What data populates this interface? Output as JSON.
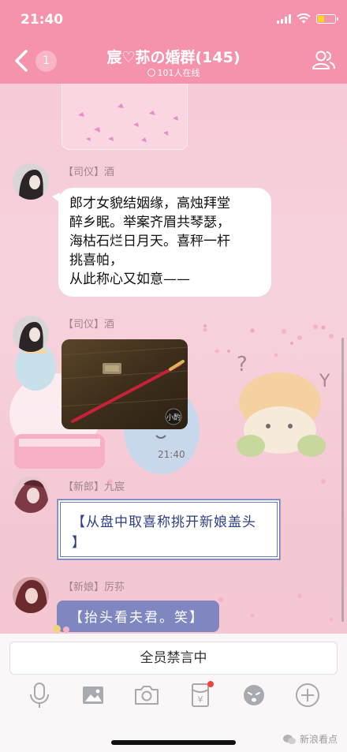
{
  "status_bar": {
    "time": "21:40"
  },
  "nav": {
    "back_count": "1",
    "title": "宸♡荪の婚群(145)",
    "online": "101人在线"
  },
  "messages": [
    {
      "role": "【司仪】",
      "sender": "酒",
      "lines": [
        "郎才女貌结姻缘，高烛拜堂",
        "醉乡眠。举案齐眉共琴瑟，",
        "海枯石烂日月天。喜秤一杆",
        "挑喜帕，",
        "从此称心又如意——"
      ]
    },
    {
      "role": "【司仪】",
      "sender": "酒",
      "photo_stamp": "小酌"
    },
    {
      "role": "【新郎】",
      "sender": "九宸",
      "lines": [
        "【从盘中取喜称挑开新娘盖头",
        "】"
      ]
    },
    {
      "role": "【新娘】",
      "sender": "厉荪",
      "text": "【抬头看夫君。笑】"
    }
  ],
  "time_tag": "21:40",
  "bottom": {
    "mute_label": "全员禁言中",
    "tools": [
      "microphone-icon",
      "image-icon",
      "camera-icon",
      "red-packet-icon",
      "emoji-icon",
      "plus-icon"
    ],
    "red_packet_symbol": "¥"
  },
  "watermark": "新浪看点",
  "colors": {
    "nav_pink": "#f592ac",
    "bubble_purple": "#7f86c0",
    "bubble_blue_border": "#6f79b8"
  }
}
